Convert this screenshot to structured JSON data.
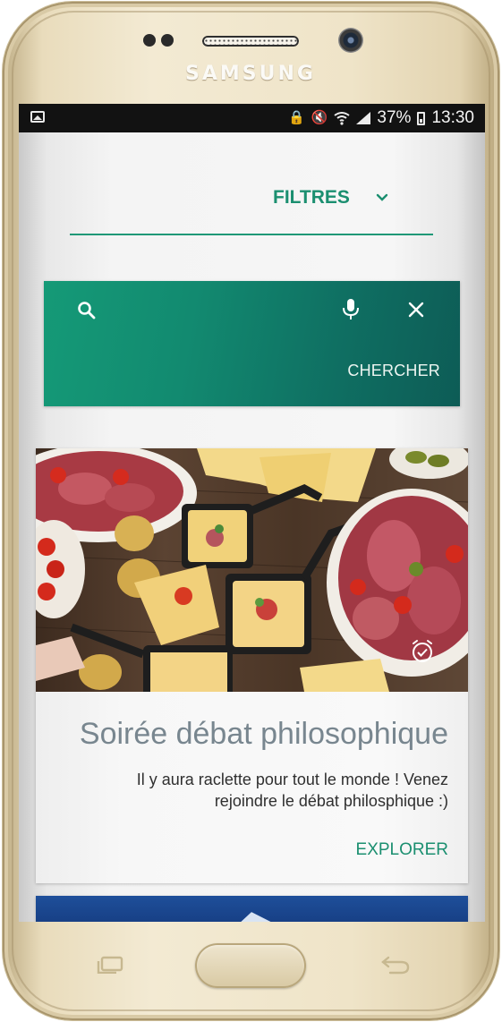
{
  "device": {
    "brand": "SAMSUNG"
  },
  "status_bar": {
    "battery": "37%",
    "time": "13:30",
    "icons": [
      "gallery-icon",
      "lock-icon",
      "mute-icon",
      "wifi-icon",
      "signal-icon",
      "battery-icon"
    ]
  },
  "filters": {
    "label": "FILTRES",
    "icon": "chevron-down-icon"
  },
  "search": {
    "value": "",
    "button_label": "CHERCHER",
    "icons": [
      "search-icon",
      "mic-icon",
      "close-icon"
    ]
  },
  "event_card": {
    "title": "Soirée débat philosophique",
    "description": "Il y aura raclette pour tout le monde ! Venez rejoindre le débat philosphique :)",
    "action_label": "EXPLORER",
    "image": "raclette-platter-image",
    "badge_icon": "timer-icon"
  },
  "colors": {
    "accent": "#1b8f70",
    "search_gradient_start": "#159a77",
    "search_gradient_end": "#0d5c56",
    "title_gray": "#78868f"
  }
}
